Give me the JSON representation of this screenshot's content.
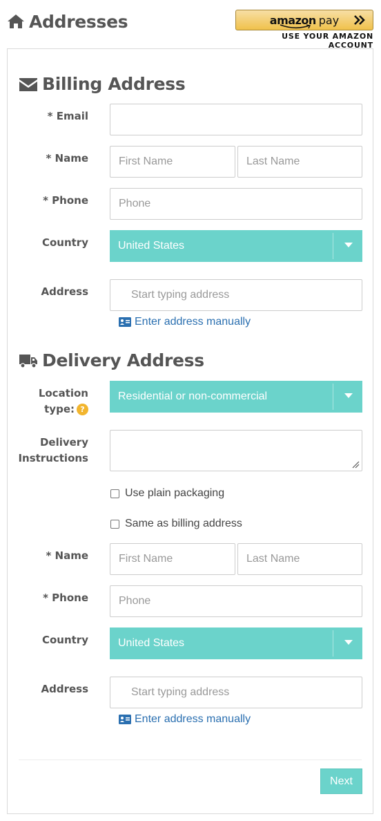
{
  "header": {
    "title": "Addresses"
  },
  "amazon_pay": {
    "brand": "amazon",
    "pay": "pay",
    "subtitle": "USE YOUR AMAZON ACCOUNT"
  },
  "billing": {
    "heading": "Billing Address",
    "email_label": "* Email",
    "email_value": "",
    "name_label": "* Name",
    "first_name_placeholder": "First Name",
    "last_name_placeholder": "Last Name",
    "phone_label": "* Phone",
    "phone_placeholder": "Phone",
    "country_label": "Country",
    "country_value": "United States",
    "address_label": "Address",
    "address_placeholder": "Start typing address",
    "manual_link": "Enter address manually"
  },
  "delivery": {
    "heading": "Delivery Address",
    "location_label_1": "Location",
    "location_label_2": "type:",
    "location_help": "?",
    "location_value": "Residential or non-commercial",
    "instructions_label_1": "Delivery",
    "instructions_label_2": "Instructions",
    "instructions_value": "",
    "plain_packaging_label": "Use plain packaging",
    "same_as_billing_label": "Same as billing address",
    "name_label": "* Name",
    "first_name_placeholder": "First Name",
    "last_name_placeholder": "Last Name",
    "phone_label": "* Phone",
    "phone_placeholder": "Phone",
    "country_label": "Country",
    "country_value": "United States",
    "address_label": "Address",
    "address_placeholder": "Start typing address",
    "manual_link": "Enter address manually"
  },
  "footer": {
    "next_label": "Next"
  },
  "colors": {
    "accent": "#6bd3cb",
    "link": "#2a6fb0",
    "help": "#f2b52e",
    "amazon_gold": "#f0c14b"
  },
  "icons": [
    "home-icon",
    "envelope-icon",
    "truck-icon",
    "address-card-icon",
    "chevron-double-right-icon",
    "caret-down-icon",
    "question-icon"
  ]
}
